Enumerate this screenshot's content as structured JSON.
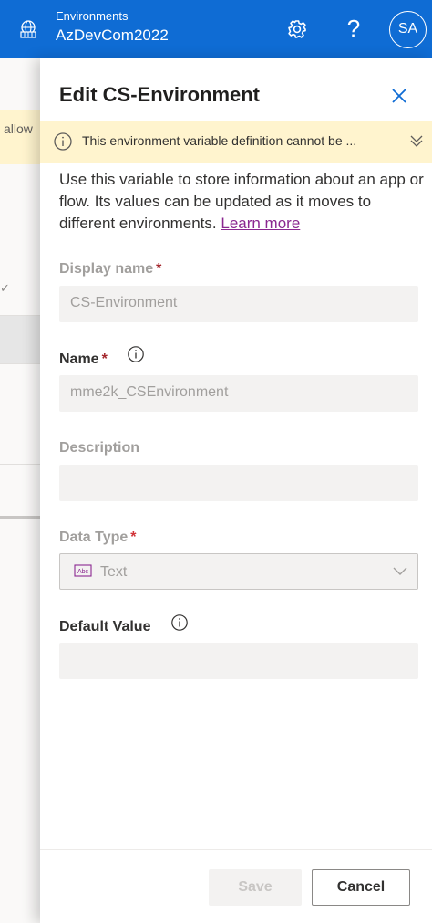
{
  "topbar": {
    "environment_label": "Environments",
    "environment_name": "AzDevCom2022",
    "icons": {
      "environment": "globe-building-icon",
      "settings": "gear-icon",
      "help": "question-icon"
    },
    "help_label": "?",
    "avatar_initials": "SA",
    "bar_color": "#0f6cd4"
  },
  "background_page": {
    "warning_fragment": "allow",
    "check_fragment": "✓"
  },
  "panel": {
    "title": "Edit CS-Environment",
    "message_bar": {
      "text": "This environment variable definition cannot be ...",
      "color": "#fff4ce"
    },
    "description": "Use this variable to store information about an app or flow. Its values can be updated as it moves to different environments.",
    "learn_more": "Learn more",
    "fields": {
      "display_name": {
        "label": "Display name",
        "required": "*",
        "value": "CS-Environment"
      },
      "name": {
        "label": "Name",
        "required": "*",
        "value": "mme2k_CSEnvironment"
      },
      "description": {
        "label": "Description",
        "value": ""
      },
      "data_type": {
        "label": "Data Type",
        "required": "*",
        "value": "Text"
      },
      "default_value": {
        "label": "Default Value",
        "value": ""
      }
    },
    "buttons": {
      "save": "Save",
      "cancel": "Cancel"
    },
    "link_color": "#8a2790",
    "required_color": "#a4262c"
  }
}
